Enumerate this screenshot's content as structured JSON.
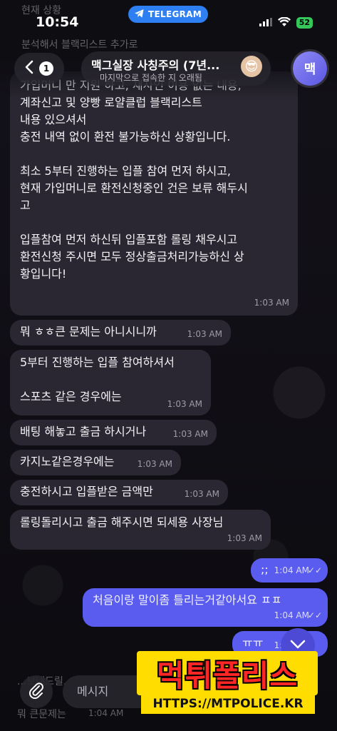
{
  "status_bar": {
    "time": "10:54",
    "app_pill": "TELEGRAM",
    "battery": "52"
  },
  "header": {
    "back_count": "1",
    "title": "맥그실장 사칭주의 (7년...",
    "subtitle": "마지막으로 접속한 지 오래됨",
    "avatar_letter": "맥"
  },
  "messages": [
    {
      "lines": "가입머니 만 지원 하고, 재사인 이용 없는 내용,\n계좌신고 및 양빵 로얄클럽 블랙리스트\n내용 있으셔서\n충전 내역 없이 환전 불가능하신 상황입니다.\n\n최소 5부터 진행하는 입플 참여 먼저 하시고,\n현재 가입머니로 환전신청중인 건은 보류 해두시\n고\n\n입플참여 먼저 하신뒤 입플포함 롤링 채우시고\n환전신청 주시면 모두 정상출금처리가능하신 상\n황입니다!",
      "time": "1:03 AM"
    },
    {
      "lines": "뭐 ㅎㅎ큰 문제는 아니시니까",
      "time": "1:03 AM"
    },
    {
      "lines": "5부터 진행하는 입플 참여하셔서\n\n스포츠 같은 경우에는",
      "time": "1:03 AM"
    },
    {
      "lines": "배팅 해놓고 출금 하시거나",
      "time": "1:03 AM"
    },
    {
      "lines": "카지노같은경우에는",
      "time": "1:03 AM"
    },
    {
      "lines": "충전하시고 입플받은 금액만",
      "time": "1:03 AM"
    },
    {
      "lines": "롤링돌리시고 출금 해주시면 되세용 사장님",
      "time": "1:03 AM"
    },
    {
      "lines": ";;",
      "time": "1:04 AM",
      "outgoing": true
    },
    {
      "lines": "처음이랑 말이좀 틀리는거같아서요 ㅍㅍ",
      "time": "1:04 AM",
      "outgoing": true
    },
    {
      "lines": "ㅠㅠ",
      "time": "1:04 AM",
      "outgoing": true
    }
  ],
  "ghost": {
    "top1": "현재 상황",
    "top2": "분석해서 블랙리스트 추가로",
    "bottom1": "...보내드릴.",
    "bottom2": "뭐 큰문제는",
    "bottom_time": "1:04 AM"
  },
  "composer": {
    "placeholder": "메시지"
  },
  "watermark": {
    "main": "먹튀폴리스",
    "url": "HTTPS://MTPOLICE.KR"
  }
}
